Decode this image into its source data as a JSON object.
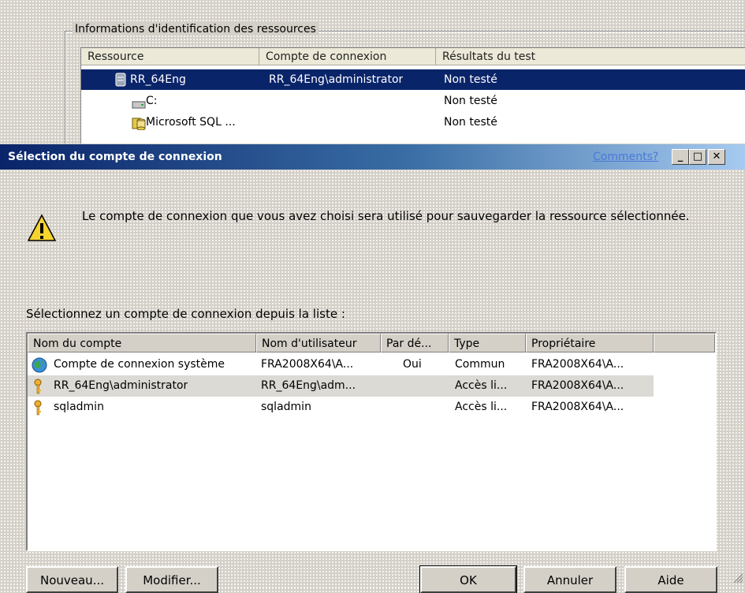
{
  "background_window": {
    "group_label": "Informations d'identification des ressources",
    "columns": [
      "Ressource",
      "Compte de connexion",
      "Résultats du test"
    ],
    "rows": [
      {
        "resource": "RR_64Eng",
        "account": "RR_64Eng\\administrator",
        "result": "Non testé",
        "icon": "server-icon",
        "selected": true
      },
      {
        "resource": "C:",
        "account": "",
        "result": "Non testé",
        "icon": "drive-icon",
        "selected": false
      },
      {
        "resource": "Microsoft SQL ...",
        "account": "",
        "result": "Non testé",
        "icon": "sql-database-icon",
        "selected": false
      }
    ]
  },
  "dialog": {
    "title": "Sélection du compte de connexion",
    "comments_link": "Comments?",
    "titlebar_buttons": {
      "minimize": "_",
      "maximize": "□",
      "close": "✕"
    },
    "message": "Le compte de connexion que vous avez choisi sera utilisé pour sauvegarder la ressource sélectionnée.",
    "select_label": "Sélectionnez un compte de connexion depuis la liste :",
    "columns": [
      "Nom du compte",
      "Nom d'utilisateur",
      "Par dé...",
      "Type",
      "Propriétaire"
    ],
    "accounts": [
      {
        "name": "Compte de connexion système",
        "user": "FRA2008X64\\A...",
        "default": "Oui",
        "type": "Commun",
        "owner": "FRA2008X64\\A...",
        "icon": "globe-icon",
        "highlighted": false
      },
      {
        "name": "RR_64Eng\\administrator",
        "user": "RR_64Eng\\adm...",
        "default": "",
        "type": "Accès li...",
        "owner": "FRA2008X64\\A...",
        "icon": "key-icon",
        "highlighted": true
      },
      {
        "name": "sqladmin",
        "user": "sqladmin",
        "default": "",
        "type": "Accès li...",
        "owner": "FRA2008X64\\A...",
        "icon": "key-icon",
        "highlighted": false
      }
    ],
    "buttons": {
      "new": "Nouveau...",
      "modify": "Modifier...",
      "ok": "OK",
      "cancel": "Annuler",
      "help": "Aide"
    }
  },
  "colors": {
    "window_bg": "#d4d0c8",
    "selection": "#0a246a",
    "titlebar_start": "#0a246a",
    "titlebar_end": "#a6caf0",
    "link": "#4a79d8"
  }
}
